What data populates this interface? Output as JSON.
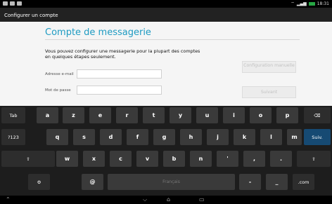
{
  "status": {
    "time": "18:31"
  },
  "action_bar": {
    "title": "Configurer un compte"
  },
  "page": {
    "title": "Compte de messagerie",
    "intro": "Vous pouvez configurer une messagerie pour la plupart des comptes\nen quelques étapes seulement.",
    "email_label": "Adresse e-mail",
    "password_label": "Mot de passe",
    "email_value": "",
    "password_value": "",
    "manual_button": "Configuration manuelle",
    "next_button": "Suivant"
  },
  "keyboard": {
    "row1": [
      "Tab",
      "a",
      "z",
      "e",
      "r",
      "t",
      "y",
      "u",
      "i",
      "o",
      "p",
      "⌫"
    ],
    "row2": [
      "?123",
      "q",
      "s",
      "d",
      "f",
      "g",
      "h",
      "j",
      "k",
      "l",
      "m",
      "Suiv."
    ],
    "row3": [
      "⇧",
      "w",
      "x",
      "c",
      "v",
      "b",
      "n",
      "'",
      ",",
      ".",
      "⇧"
    ],
    "row4": [
      "⚙",
      "@",
      "Français",
      "-",
      "_",
      ".com"
    ]
  },
  "nav": {
    "back": "⌵",
    "home": "⌂",
    "recents": "▭",
    "menu": "⌃"
  }
}
